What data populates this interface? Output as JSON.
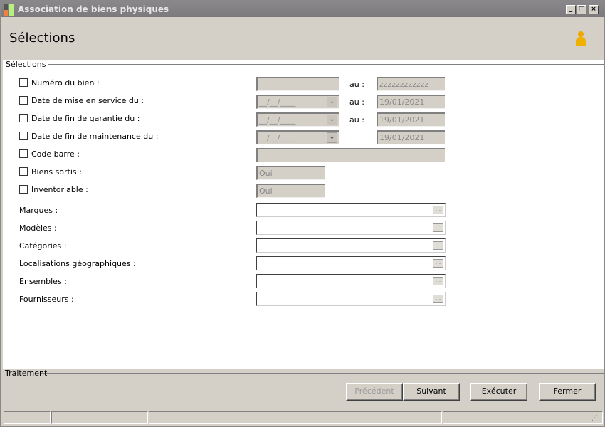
{
  "window": {
    "title": "Association de biens physiques",
    "minimize": "_",
    "maximize": "□",
    "close": "×"
  },
  "header": {
    "title": "Sélections"
  },
  "selections": {
    "legend": "Sélections",
    "au": "au :",
    "checkrows": [
      {
        "label": "Numéro du bien :",
        "type": "text",
        "from": "",
        "to": "zzzzzzzzzzzz",
        "has_au": true
      },
      {
        "label": "Date de mise en service du :",
        "type": "date",
        "from": "__/__/____",
        "to": "19/01/2021",
        "has_au": true
      },
      {
        "label": "Date de fin de garantie du :",
        "type": "date",
        "from": "__/__/____",
        "to": "19/01/2021",
        "has_au": true
      },
      {
        "label": "Date de fin de maintenance du :",
        "type": "date",
        "from": "__/__/____",
        "to": "19/01/2021",
        "has_au": false
      },
      {
        "label": "Code barre :",
        "type": "wide",
        "from": ""
      },
      {
        "label": "Biens sortis :",
        "type": "short",
        "from": "Oui"
      },
      {
        "label": "Inventoriable :",
        "type": "short",
        "from": "Oui"
      }
    ],
    "browse_rows": [
      "Marques :",
      "Modèles :",
      "Catégories :",
      "Localisations géographiques :",
      "Ensembles :",
      "Fournisseurs :"
    ],
    "browse_button": "..."
  },
  "traitement": {
    "legend": "Traitement",
    "buttons": [
      {
        "label": "Précédent",
        "disabled": true
      },
      {
        "label": "Suivant"
      },
      {
        "label": "Exécuter"
      },
      {
        "label": "Fermer"
      }
    ]
  }
}
